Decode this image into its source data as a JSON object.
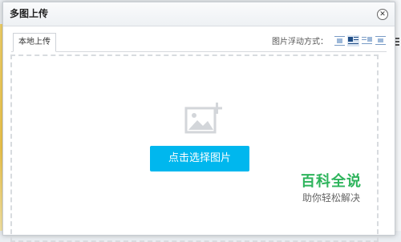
{
  "dialog": {
    "title": "多图上传",
    "close_glyph": "✕"
  },
  "tabs": [
    {
      "label": "本地上传"
    }
  ],
  "float_options": {
    "label": "图片浮动方式：",
    "options": [
      "none-align-icon",
      "left-align-icon",
      "right-align-icon",
      "center-align-icon"
    ],
    "selected": "left-align-icon"
  },
  "upload": {
    "button_label": "点击选择图片",
    "icon": "add-image-icon"
  },
  "watermark": {
    "title": "百科全说",
    "subtitle": "助你轻松解决"
  },
  "colors": {
    "primary_button": "#00b7ee",
    "watermark_green": "#2eb45c"
  }
}
